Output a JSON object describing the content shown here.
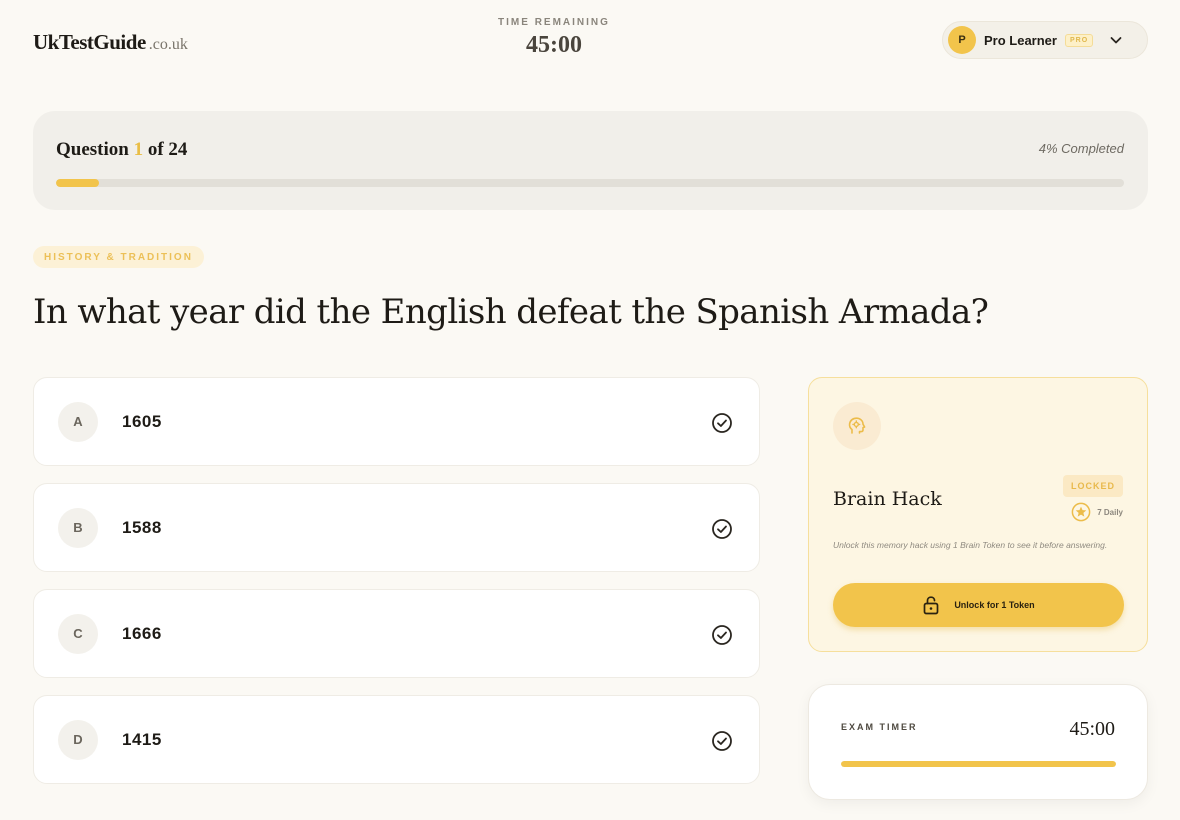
{
  "header": {
    "logo_main": "UkTestGuide",
    "logo_suffix": ".co.uk",
    "timer_label": "TIME REMAINING",
    "timer_value": "45:00",
    "user": {
      "avatar_initial": "P",
      "name": "Pro Learner",
      "badge": "PRO"
    }
  },
  "progress": {
    "prefix": "Question ",
    "current": "1",
    "suffix": " of 24",
    "completed_text": "4% Completed",
    "fraction": 0.04
  },
  "question": {
    "category": "HISTORY & TRADITION",
    "text": "In what year did the English defeat the Spanish Armada?",
    "options": [
      {
        "letter": "A",
        "text": "1605"
      },
      {
        "letter": "B",
        "text": "1588"
      },
      {
        "letter": "C",
        "text": "1666"
      },
      {
        "letter": "D",
        "text": "1415"
      }
    ]
  },
  "brain_hack": {
    "title": "Brain Hack",
    "status": "LOCKED",
    "daily": "7 Daily",
    "description": "Unlock this memory hack using 1 Brain Token to see it before answering.",
    "button": "Unlock for 1 Token"
  },
  "exam_timer": {
    "label": "EXAM TIMER",
    "value": "45:00",
    "fraction": 1.0
  },
  "colors": {
    "accent": "#f2c44b",
    "background": "#fbf9f4",
    "text": "#1e1b16"
  },
  "icons": {
    "chevron": "chevron-down-icon",
    "check": "check-circle-icon",
    "brain": "brain-gear-icon",
    "star": "star-circle-icon",
    "lock": "lock-open-icon"
  }
}
